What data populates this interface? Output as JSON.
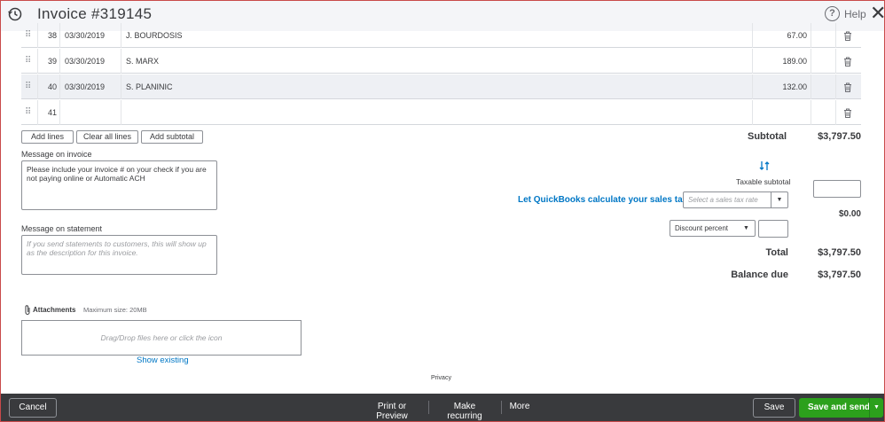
{
  "header": {
    "title": "Invoice #319145",
    "help_label": "Help"
  },
  "rows": [
    {
      "num": "38",
      "date": "03/30/2019",
      "name": "J. BOURDOSIS",
      "amount": "67.00"
    },
    {
      "num": "39",
      "date": "03/30/2019",
      "name": "S. MARX",
      "amount": "189.00"
    },
    {
      "num": "40",
      "date": "03/30/2019",
      "name": "S. PLANINIC",
      "amount": "132.00"
    },
    {
      "num": "41",
      "date": "",
      "name": "",
      "amount": ""
    }
  ],
  "line_buttons": {
    "add_lines": "Add lines",
    "clear_all": "Clear all lines",
    "add_subtotal": "Add subtotal"
  },
  "message_invoice": {
    "label": "Message on invoice",
    "value": "Please include your invoice # on your check if you are not paying online or Automatic ACH"
  },
  "message_statement": {
    "label": "Message on statement",
    "placeholder": "If you send statements to customers, this will show up as the description for this invoice."
  },
  "totals": {
    "subtotal_label": "Subtotal",
    "subtotal_value": "$3,797.50",
    "taxable_label": "Taxable subtotal",
    "tax_link": "Let QuickBooks calculate your sales tax",
    "tax_rate_placeholder": "Select a sales tax rate",
    "tax_value": "$0.00",
    "discount_select": "Discount percent",
    "total_label": "Total",
    "total_value": "$3,797.50",
    "balance_label": "Balance due",
    "balance_value": "$3,797.50"
  },
  "attachments": {
    "label": "Attachments",
    "max_size": "Maximum size: 20MB",
    "drop_text": "Drag/Drop files here or click the icon",
    "show_existing": "Show existing"
  },
  "privacy": "Privacy",
  "footer": {
    "cancel": "Cancel",
    "print_preview": "Print or Preview",
    "make_recurring": "Make recurring",
    "more": "More",
    "save": "Save",
    "save_send": "Save and send"
  },
  "colors": {
    "accent_green": "#2ca01c",
    "link_blue": "#0077c5",
    "footer_bg": "#393a3d"
  }
}
